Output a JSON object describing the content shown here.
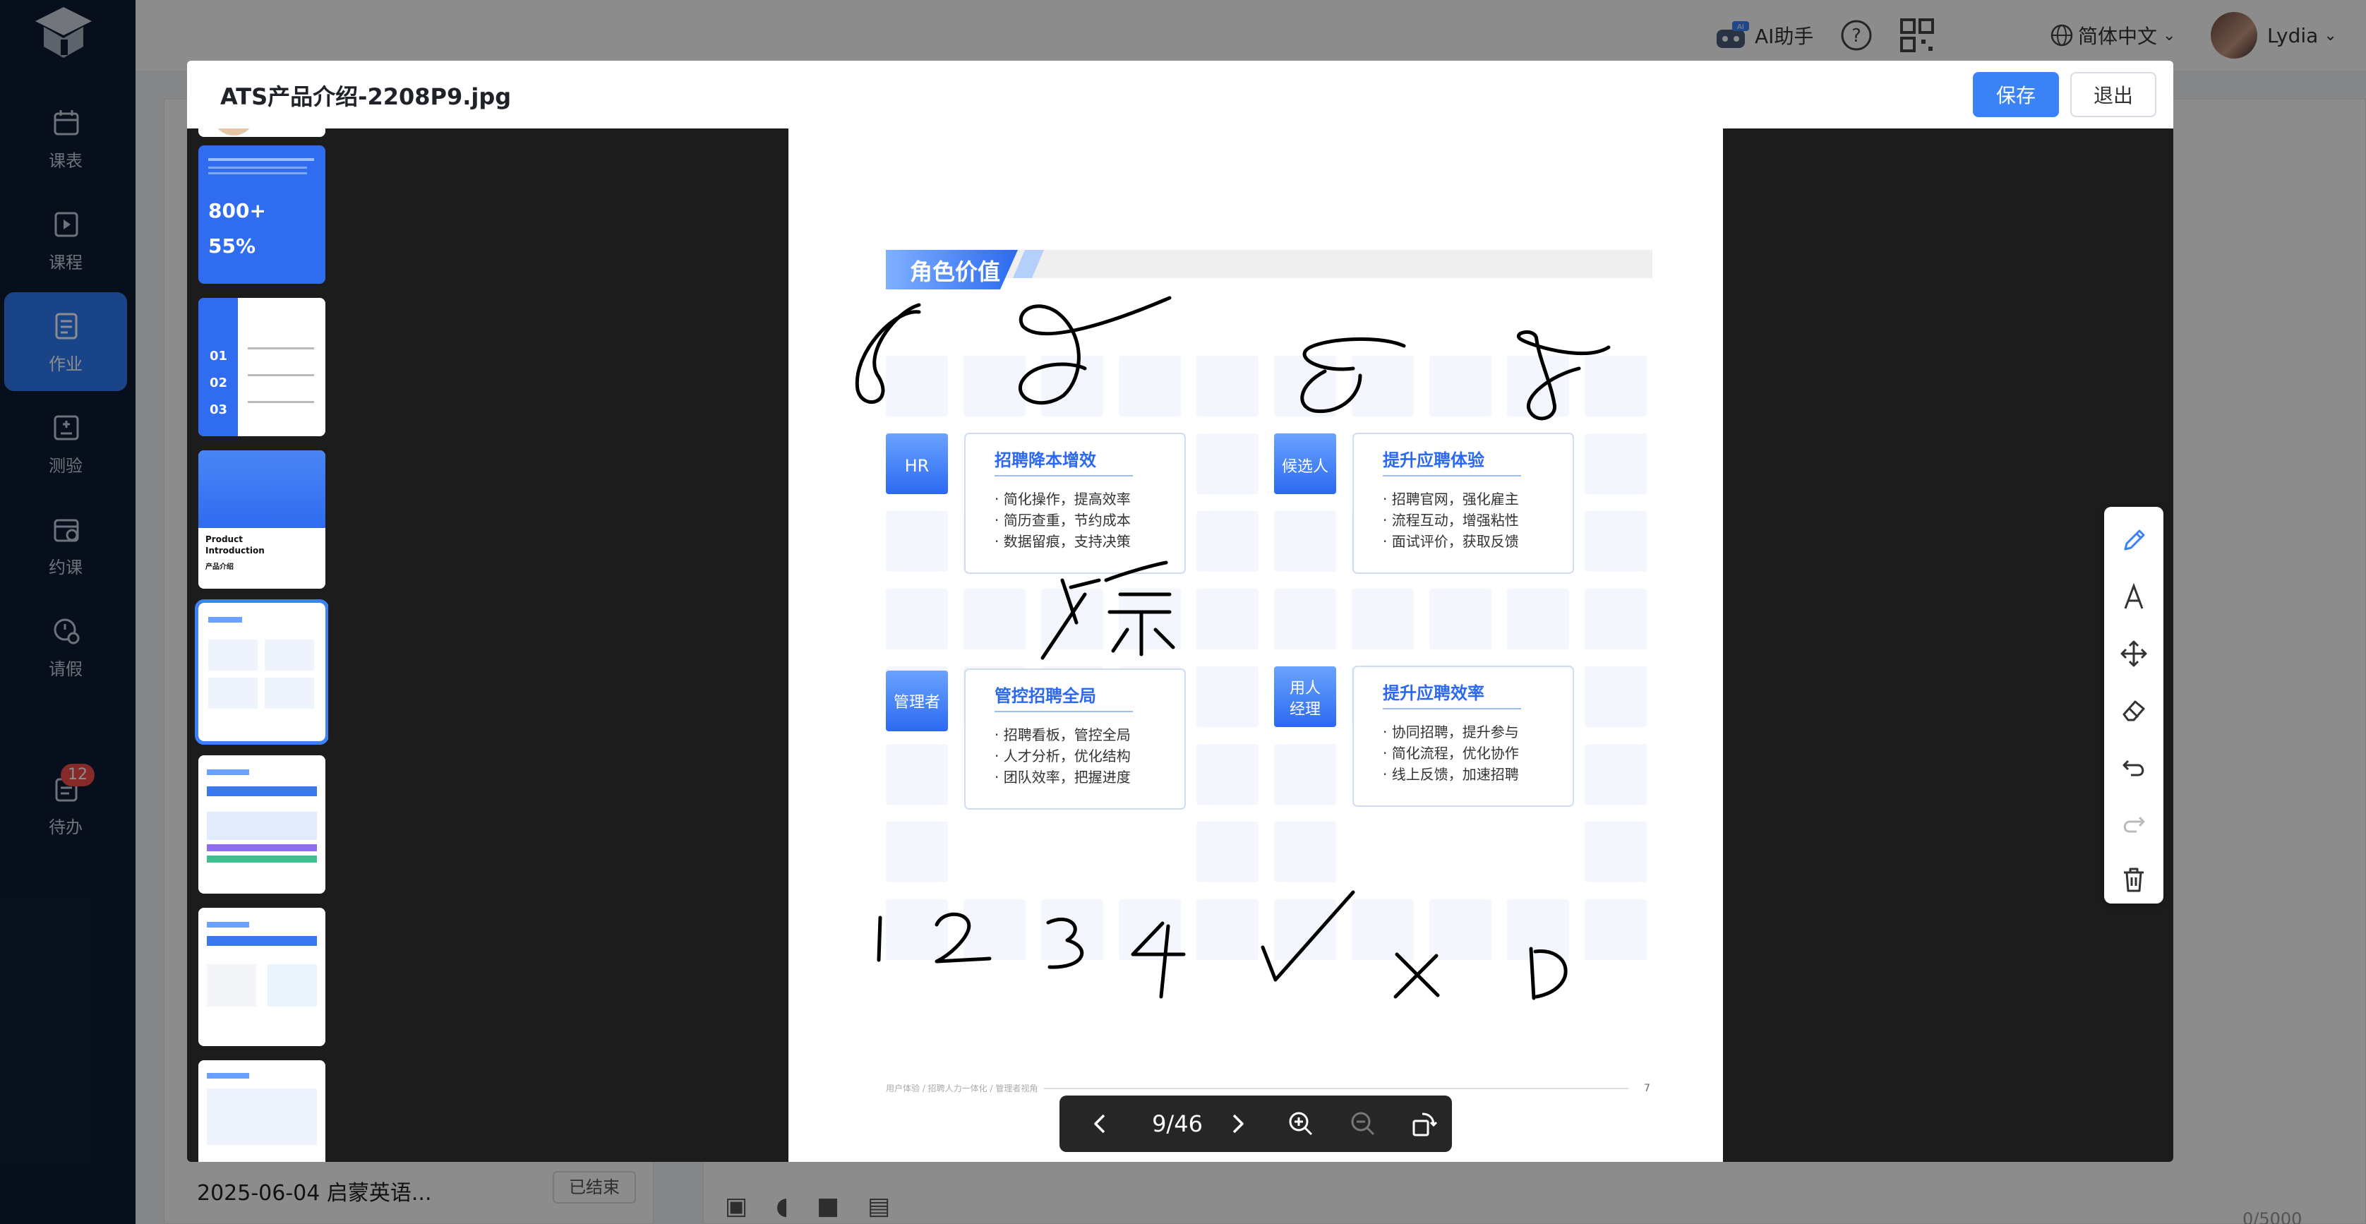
{
  "sidebar": {
    "items": [
      {
        "label": "课表",
        "icon": "calendar-icon"
      },
      {
        "label": "课程",
        "icon": "video-icon"
      },
      {
        "label": "作业",
        "icon": "homework-icon"
      },
      {
        "label": "测验",
        "icon": "quiz-icon"
      },
      {
        "label": "约课",
        "icon": "book-class-icon"
      },
      {
        "label": "请假",
        "icon": "leave-icon"
      },
      {
        "label": "待办",
        "icon": "todo-icon",
        "badge": "12"
      }
    ],
    "active_index": 2
  },
  "topbar": {
    "ai_label": "AI助手",
    "ai_badge": "AI",
    "language": "简体中文",
    "user": "Lydia"
  },
  "background": {
    "task_date": "2025-06-04 启蒙英语...",
    "task_status": "已结束",
    "counter": "0/5000"
  },
  "modal": {
    "title": "ATS产品介绍-2208P9.jpg",
    "save_label": "保存",
    "exit_label": "退出"
  },
  "thumbs": {
    "t2_stat1": "800+",
    "t2_stat2": "55%",
    "t3_nums": [
      "01",
      "02",
      "03"
    ],
    "t4_title_en1": "Product",
    "t4_title_en2": "Introduction",
    "t4_title_cn": "产品介绍"
  },
  "slide": {
    "header": "角色价值",
    "cards": [
      {
        "role": "HR",
        "title": "招聘降本增效",
        "lines": [
          "· 简化操作，提高效率",
          "· 简历查重，节约成本",
          "· 数据留痕，支持决策"
        ]
      },
      {
        "role": "候选人",
        "title": "提升应聘体验",
        "lines": [
          "· 招聘官网，强化雇主",
          "· 流程互动，增强粘性",
          "· 面试评价，获取反馈"
        ]
      },
      {
        "role": "管理者",
        "title": "管控招聘全局",
        "lines": [
          "· 招聘看板，管控全局",
          "· 人才分析，优化结构",
          "· 团队效率，把握进度"
        ]
      },
      {
        "role_line1": "用人",
        "role_line2": "经理",
        "title": "提升应聘效率",
        "lines": [
          "· 协同招聘，提升参与",
          "· 简化流程，优化协作",
          "· 线上反馈，加速招聘"
        ]
      }
    ],
    "footer": "用户体验 / 招聘人力一体化 / 管理者视角",
    "page_number": "7"
  },
  "pager": {
    "current": "9/46"
  },
  "tools": [
    "pencil-icon",
    "text-icon",
    "move-icon",
    "eraser-icon",
    "undo-icon",
    "redo-icon",
    "delete-icon"
  ]
}
